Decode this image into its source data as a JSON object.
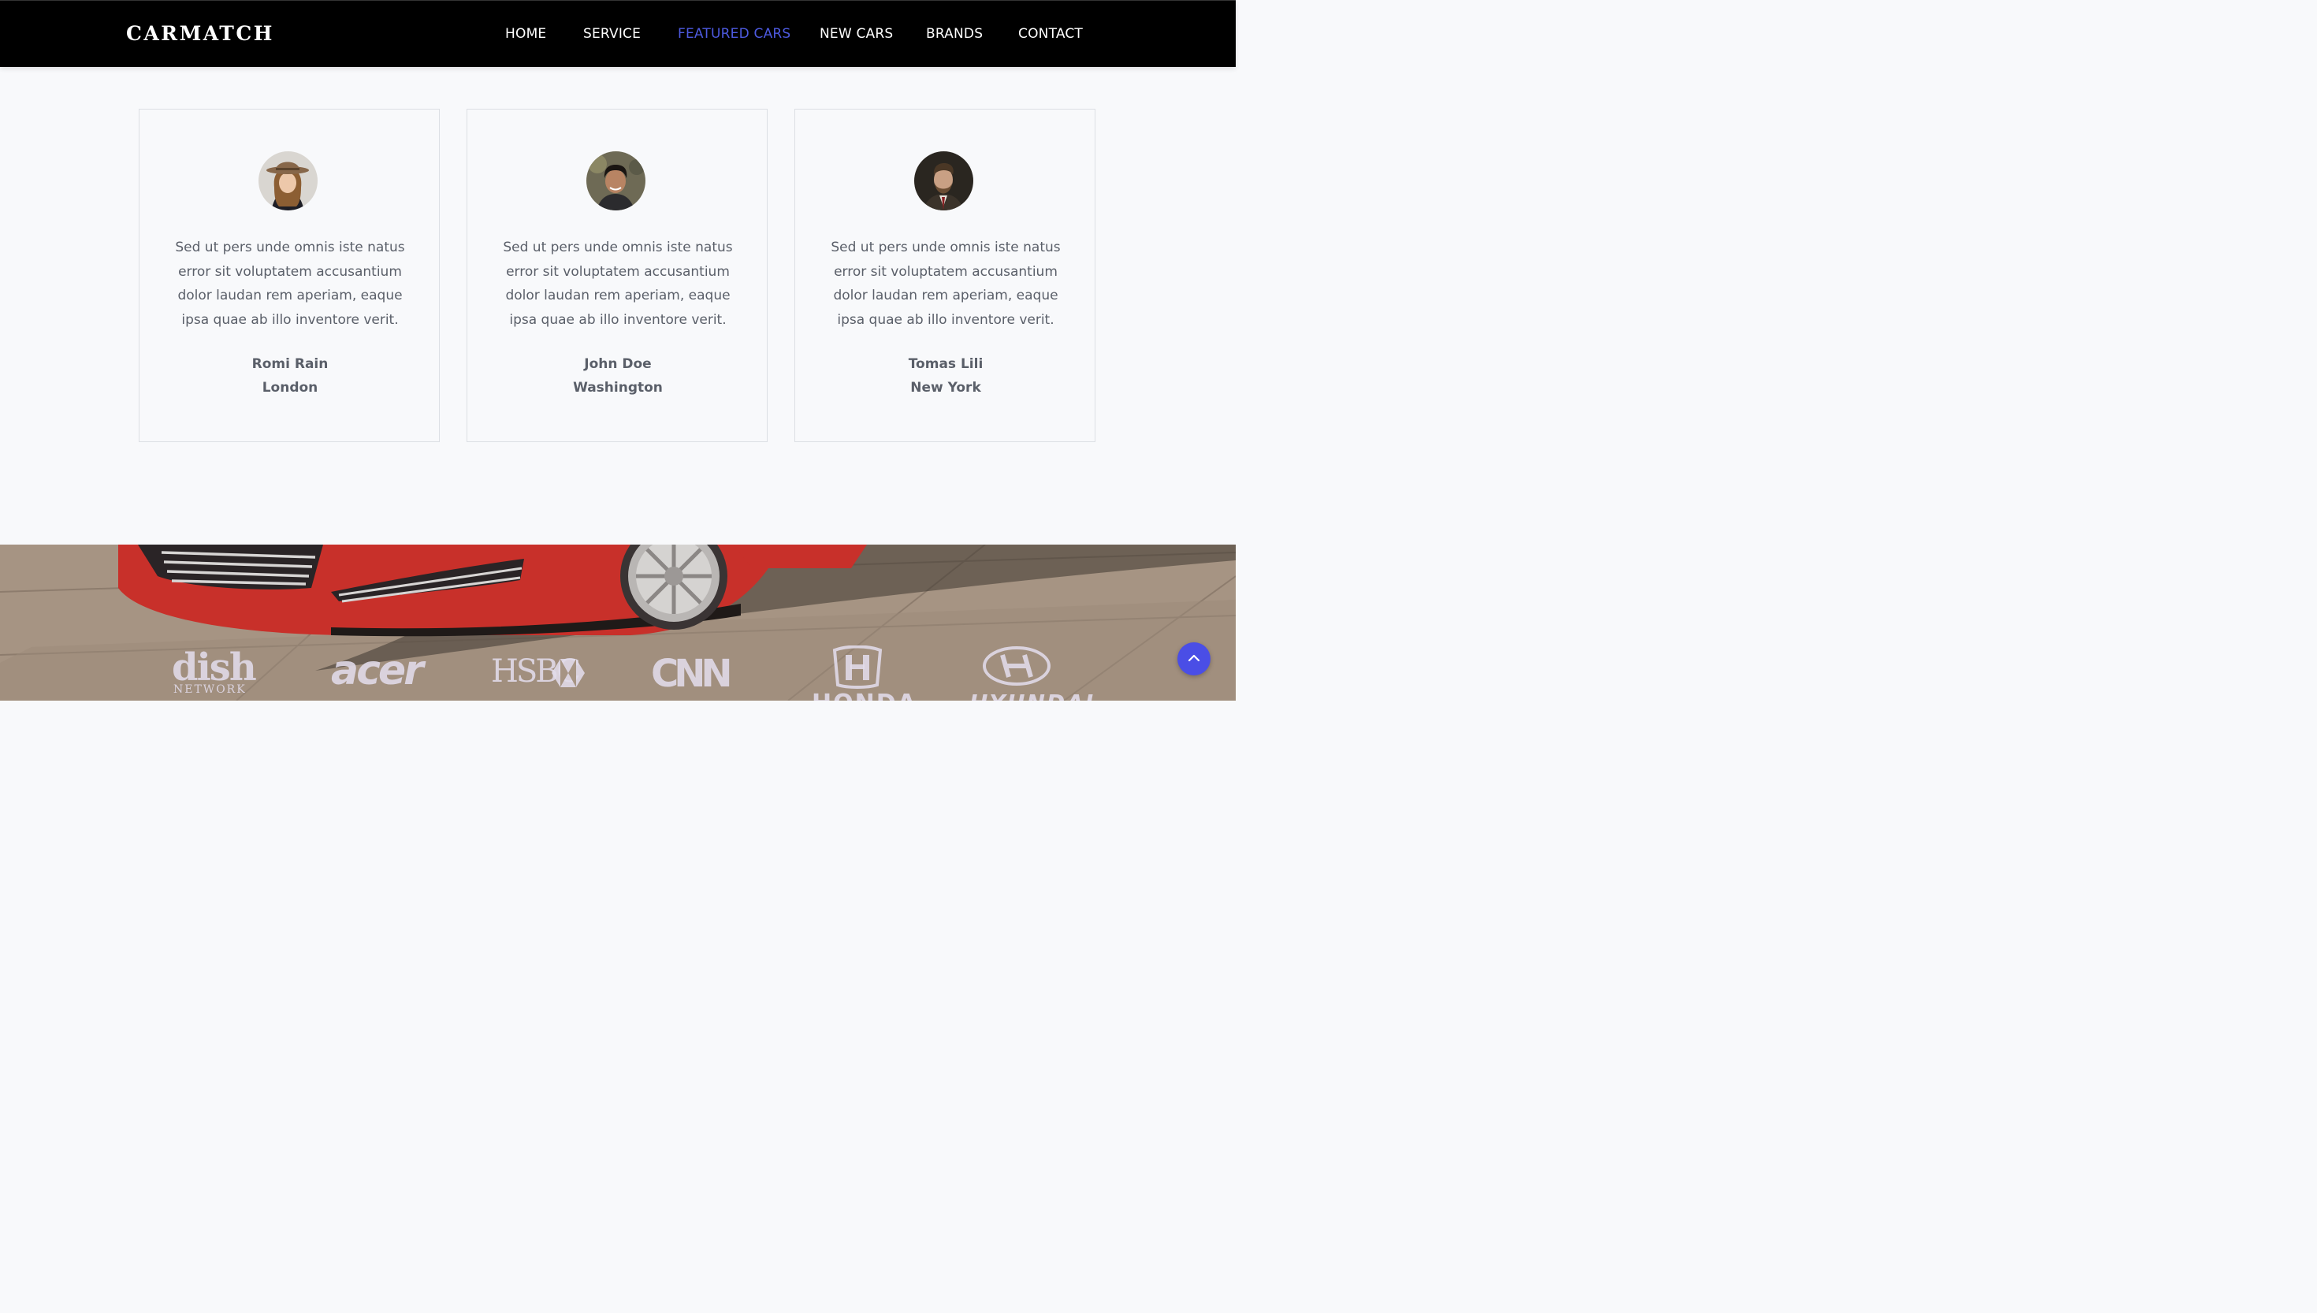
{
  "navbar": {
    "brand": "CARMATCH",
    "items": [
      {
        "label": "HOME"
      },
      {
        "label": "SERVICE"
      },
      {
        "label": "FEATURED CARS"
      },
      {
        "label": "NEW CARS"
      },
      {
        "label": "BRANDS"
      },
      {
        "label": "CONTACT"
      }
    ],
    "active_item": "FEATURED CARS"
  },
  "testimonials": [
    {
      "quote": "Sed ut pers unde omnis iste natus error sit voluptatem accusantium dolor laudan rem aperiam, eaque ipsa quae ab illo inventore verit.",
      "name": "Romi Rain",
      "city": "London"
    },
    {
      "quote": "Sed ut pers unde omnis iste natus error sit voluptatem accusantium dolor laudan rem aperiam, eaque ipsa quae ab illo inventore verit.",
      "name": "John Doe",
      "city": "Washington"
    },
    {
      "quote": "Sed ut pers unde omnis iste natus error sit voluptatem accusantium dolor laudan rem aperiam, eaque ipsa quae ab illo inventore verit.",
      "name": "Tomas Lili",
      "city": "New York"
    }
  ],
  "brands": {
    "logos": [
      "dish",
      "NETWORK",
      "acer",
      "HSBC",
      "CNN",
      "HONDA",
      "HYUNDAI"
    ]
  },
  "scroll_top": {
    "icon": "chevron-up-icon"
  },
  "colors": {
    "navbar_bg": "#000000",
    "accent": "#4d5ae0",
    "text_muted": "#5a5f69",
    "page_bg": "#f8f9fb",
    "scroll_button": "#4a4ee6"
  }
}
